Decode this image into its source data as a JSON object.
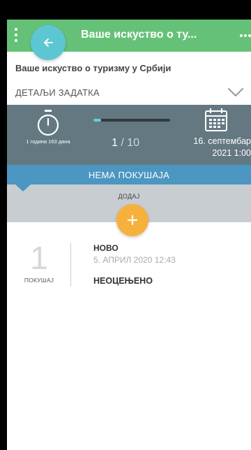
{
  "app_bar": {
    "title": "Ваше искуство о ту...",
    "background": "#66c178"
  },
  "heading": "Ваше искуство о туризму у Србији",
  "details": {
    "label": "ДЕТАЉИ ЗАДАТКА"
  },
  "stats": {
    "duration": "1 година 163 дана",
    "progress": {
      "current": "1",
      "separator": "/",
      "total": "10",
      "fraction": 0.1
    },
    "due_date_line1": "16. септембар",
    "due_date_line2": "2021 1:00"
  },
  "status_banner": "НЕМА ПОКУШАЈА",
  "add": {
    "label": "ДОДАЈ"
  },
  "attempt": {
    "number": "1",
    "caption": "ПОКУШАЈ",
    "state": "НОВО",
    "date": "5. АПРИЛ 2020 12:43",
    "grade": "НЕОЦЕЊЕНО"
  },
  "icons": {
    "menu": "kebab-menu-icon",
    "back": "arrow-left-icon",
    "more": "more-horizontal-icon",
    "expand": "chevron-down-icon",
    "timer": "stopwatch-icon",
    "calendar": "calendar-icon",
    "add": "plus-icon"
  },
  "colors": {
    "primary": "#66c178",
    "accent_back": "#5cc6d2",
    "stats_bg": "#647882",
    "banner": "#4c96c2",
    "add_fab": "#f6b03c",
    "progress_fill": "#5ed2e0"
  }
}
